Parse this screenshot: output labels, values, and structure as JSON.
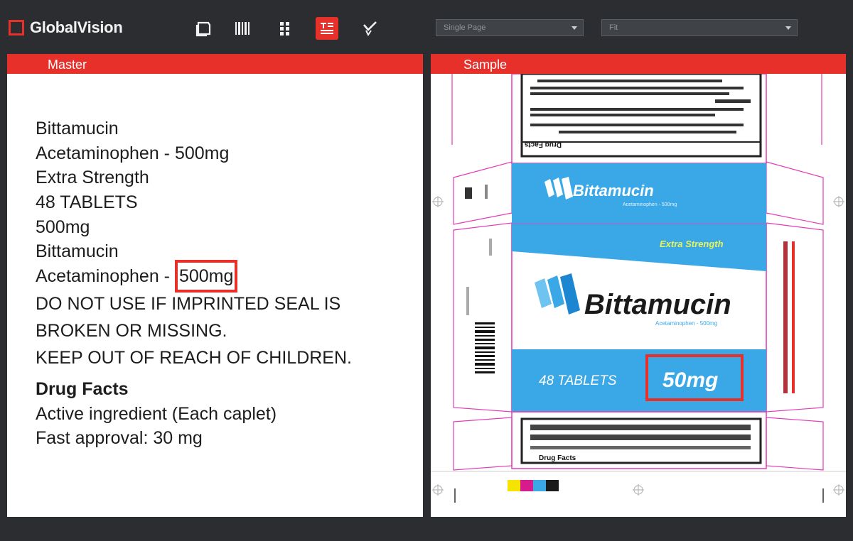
{
  "app": {
    "logo_text": "GlobalVision"
  },
  "toolbar": {
    "icons": [
      "pages-icon",
      "barcode-icon",
      "grid-icon",
      "text-compare-icon",
      "spellcheck-icon"
    ],
    "active_index": 3,
    "accent_color": "#e8302a"
  },
  "dropdowns": {
    "view_mode": "Single Page",
    "zoom": "Fit"
  },
  "master": {
    "header": "Master",
    "lines": [
      "Bittamucin",
      "Acetaminophen - 500mg",
      "Extra Strength",
      "48 TABLETS",
      "500mg",
      "Bittamucin"
    ],
    "highlight_line_prefix": "Acetaminophen - ",
    "highlight_value": "500mg",
    "warning_lines": [
      "DO NOT USE IF IMPRINTED SEAL IS",
      "BROKEN OR MISSING.",
      "KEEP OUT OF REACH OF CHILDREN."
    ],
    "drug_facts_title": "Drug Facts",
    "footer_lines": [
      "Active ingredient (Each caplet)",
      "Fast approval: 30 mg"
    ]
  },
  "sample": {
    "header": "Sample",
    "box": {
      "brand_top": "Bittamucin",
      "sub_top": "Acetaminophen - 500mg",
      "extra_strength": "Extra Strength",
      "brand_main": "Bittamucin",
      "sub_main": "Acetaminophen - 500mg",
      "tablets": "48 TABLETS",
      "dose": "50mg",
      "drug_facts": "Drug Facts",
      "brand_color": "#3aa8e6",
      "dieline_color": "#e23bb8"
    }
  }
}
